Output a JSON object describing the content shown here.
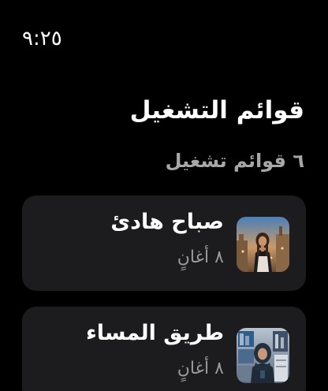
{
  "status_bar": {
    "time": "٩:٢٥"
  },
  "header": {
    "title": "قوائم التشغيل",
    "count_label": "٦ قوائم تشغيل"
  },
  "playlists": [
    {
      "title": "صباح هادئ",
      "subtitle": "٨ أغانٍ",
      "thumbnail": "woman-on-terrace-at-sunset-photo"
    },
    {
      "title": "طريق المساء",
      "subtitle": "٨ أغانٍ",
      "thumbnail": "woman-with-hijab-in-city-collage-photo"
    }
  ],
  "colors": {
    "background": "#000000",
    "card": "#1c1c1e",
    "primary_text": "#ffffff",
    "secondary_text": "#9a9a9a"
  }
}
